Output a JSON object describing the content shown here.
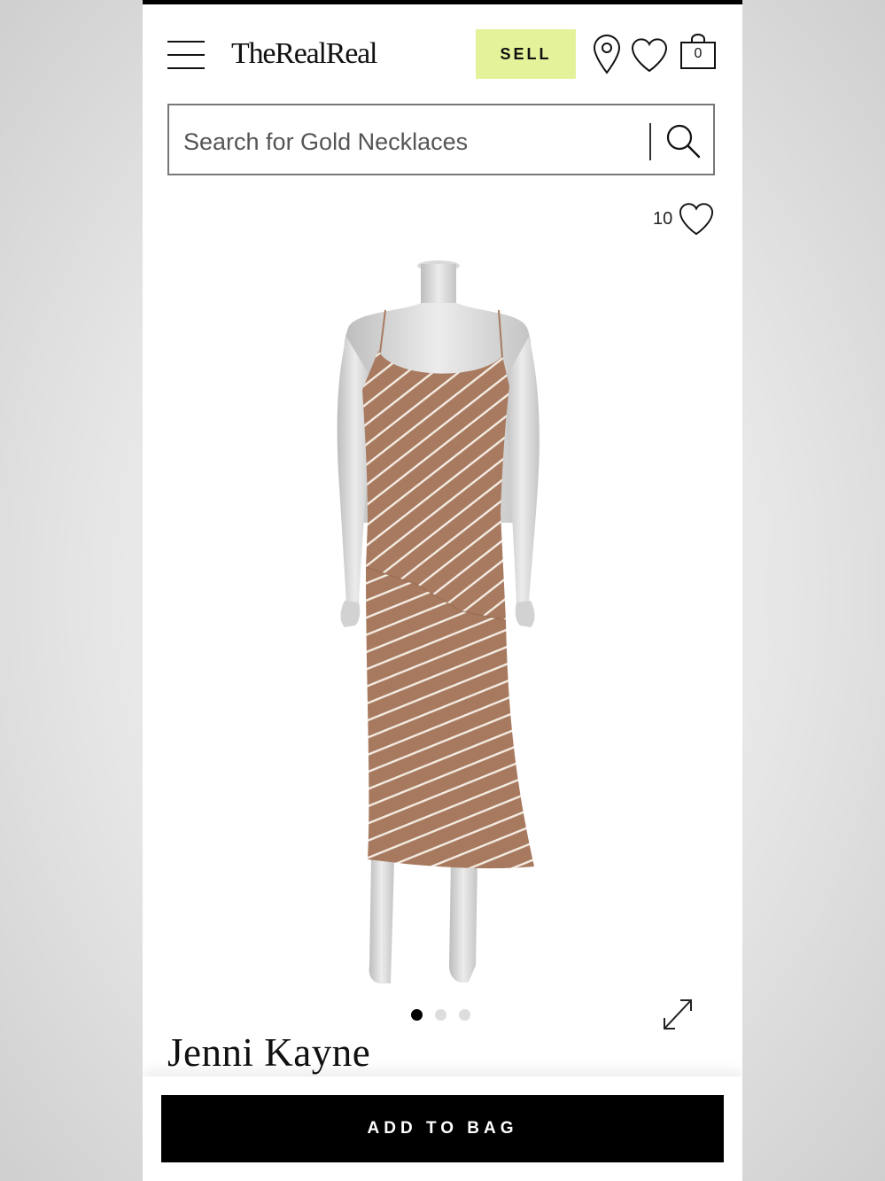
{
  "header": {
    "logo": "TheRealReal",
    "sell_label": "SELL",
    "bag_count": "0",
    "icons": [
      "menu-icon",
      "location-pin-icon",
      "heart-icon",
      "bag-icon"
    ]
  },
  "search": {
    "placeholder": "Search for Gold Necklaces",
    "icon": "search-icon"
  },
  "product": {
    "favorites_count": "10",
    "brand": "Jenni Kayne",
    "image_dots_total": 3,
    "image_dot_active": 1
  },
  "footer": {
    "add_to_bag_label": "ADD TO BAG"
  },
  "colors": {
    "sell_bg": "#e4f29a",
    "dress": "#a87a60",
    "primary": "#000000"
  }
}
